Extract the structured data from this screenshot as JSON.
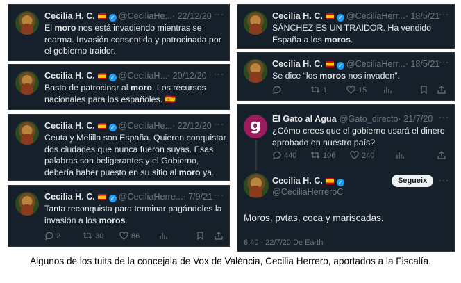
{
  "tweets": [
    {
      "name": "Cecilia H. C.",
      "handle": "@CeciliaHe...",
      "date": "· 22/12/20",
      "text_parts": [
        {
          "t": "El "
        },
        {
          "t": "moro",
          "b": true
        },
        {
          "t": " nos está invadiendo mientras se rearma. Invasión consentida y patrocinada por el gobierno traidor."
        }
      ]
    },
    {
      "name": "Cecilia H. C.",
      "handle": "@CeciliaH...",
      "date": "· 20/12/20",
      "text_parts": [
        {
          "t": "Basta de patrocinar al "
        },
        {
          "t": "moro",
          "b": true
        },
        {
          "t": ". Los recursos nacionales para los españoles. 🇪🇸"
        }
      ]
    },
    {
      "name": "Cecilia H. C.",
      "handle": "@CeciliaHe...",
      "date": "· 22/12/20",
      "text_parts": [
        {
          "t": "Ceuta y Melilla son España. Quieren conquistar dos ciudades que nunca fueron suyas. Esas palabras son beligerantes y el Gobierno, debería haber puesto en su sitio al "
        },
        {
          "t": "moro",
          "b": true
        },
        {
          "t": " ya."
        }
      ]
    },
    {
      "name": "Cecilia H. C.",
      "handle": "@CeciliaHerre...",
      "date": "· 7/9/21",
      "text_parts": [
        {
          "t": "Tanta reconquista para terminar pagándoles la invasión a los "
        },
        {
          "t": "moros",
          "b": true
        },
        {
          "t": "."
        }
      ],
      "actions": {
        "replies": "2",
        "retweets": "30",
        "likes": "86"
      }
    },
    {
      "name": "Cecilia H. C.",
      "handle": "@CeciliaHerr...",
      "date": "· 18/5/21",
      "text_parts": [
        {
          "t": "SÁNCHEZ ES UN TRAIDOR. Ha vendido España a los "
        },
        {
          "t": "moros",
          "b": true
        },
        {
          "t": "."
        }
      ]
    },
    {
      "name": "Cecilia H. C.",
      "handle": "@CeciliaHerr...",
      "date": "· 18/5/21",
      "text_parts": [
        {
          "t": "Se dice “los "
        },
        {
          "t": "moros",
          "b": true
        },
        {
          "t": " nos invaden”."
        }
      ],
      "actions": {
        "replies": "",
        "retweets": "1",
        "likes": "15"
      }
    },
    {
      "name": "El Gato al Agua",
      "handle": "@Gato_directo",
      "date": "· 21/7/20",
      "text_parts": [
        {
          "t": "¿Cómo crees que el gobierno usará el dinero aprobado en nuestro país?"
        }
      ],
      "actions": {
        "replies": "440",
        "retweets": "106",
        "likes": "240"
      }
    }
  ],
  "reply": {
    "name": "Cecilia H. C.",
    "handle": "@CeciliaHerreroC",
    "follow_label": "Segueix",
    "text": "Moros, pvtas, coca y mariscadas.",
    "meta": "6:40 · 22/7/20 De Earth"
  },
  "gato_avatar_letter": "g",
  "caption": "Algunos de los tuits de la concejala de Vox de València, Cecilia Herrero, aportados a la Fiscalía.",
  "colors": {
    "card_bg": "#15202b",
    "text": "#e7e9ea",
    "muted": "#71767b",
    "verified": "#1d9bf0"
  }
}
